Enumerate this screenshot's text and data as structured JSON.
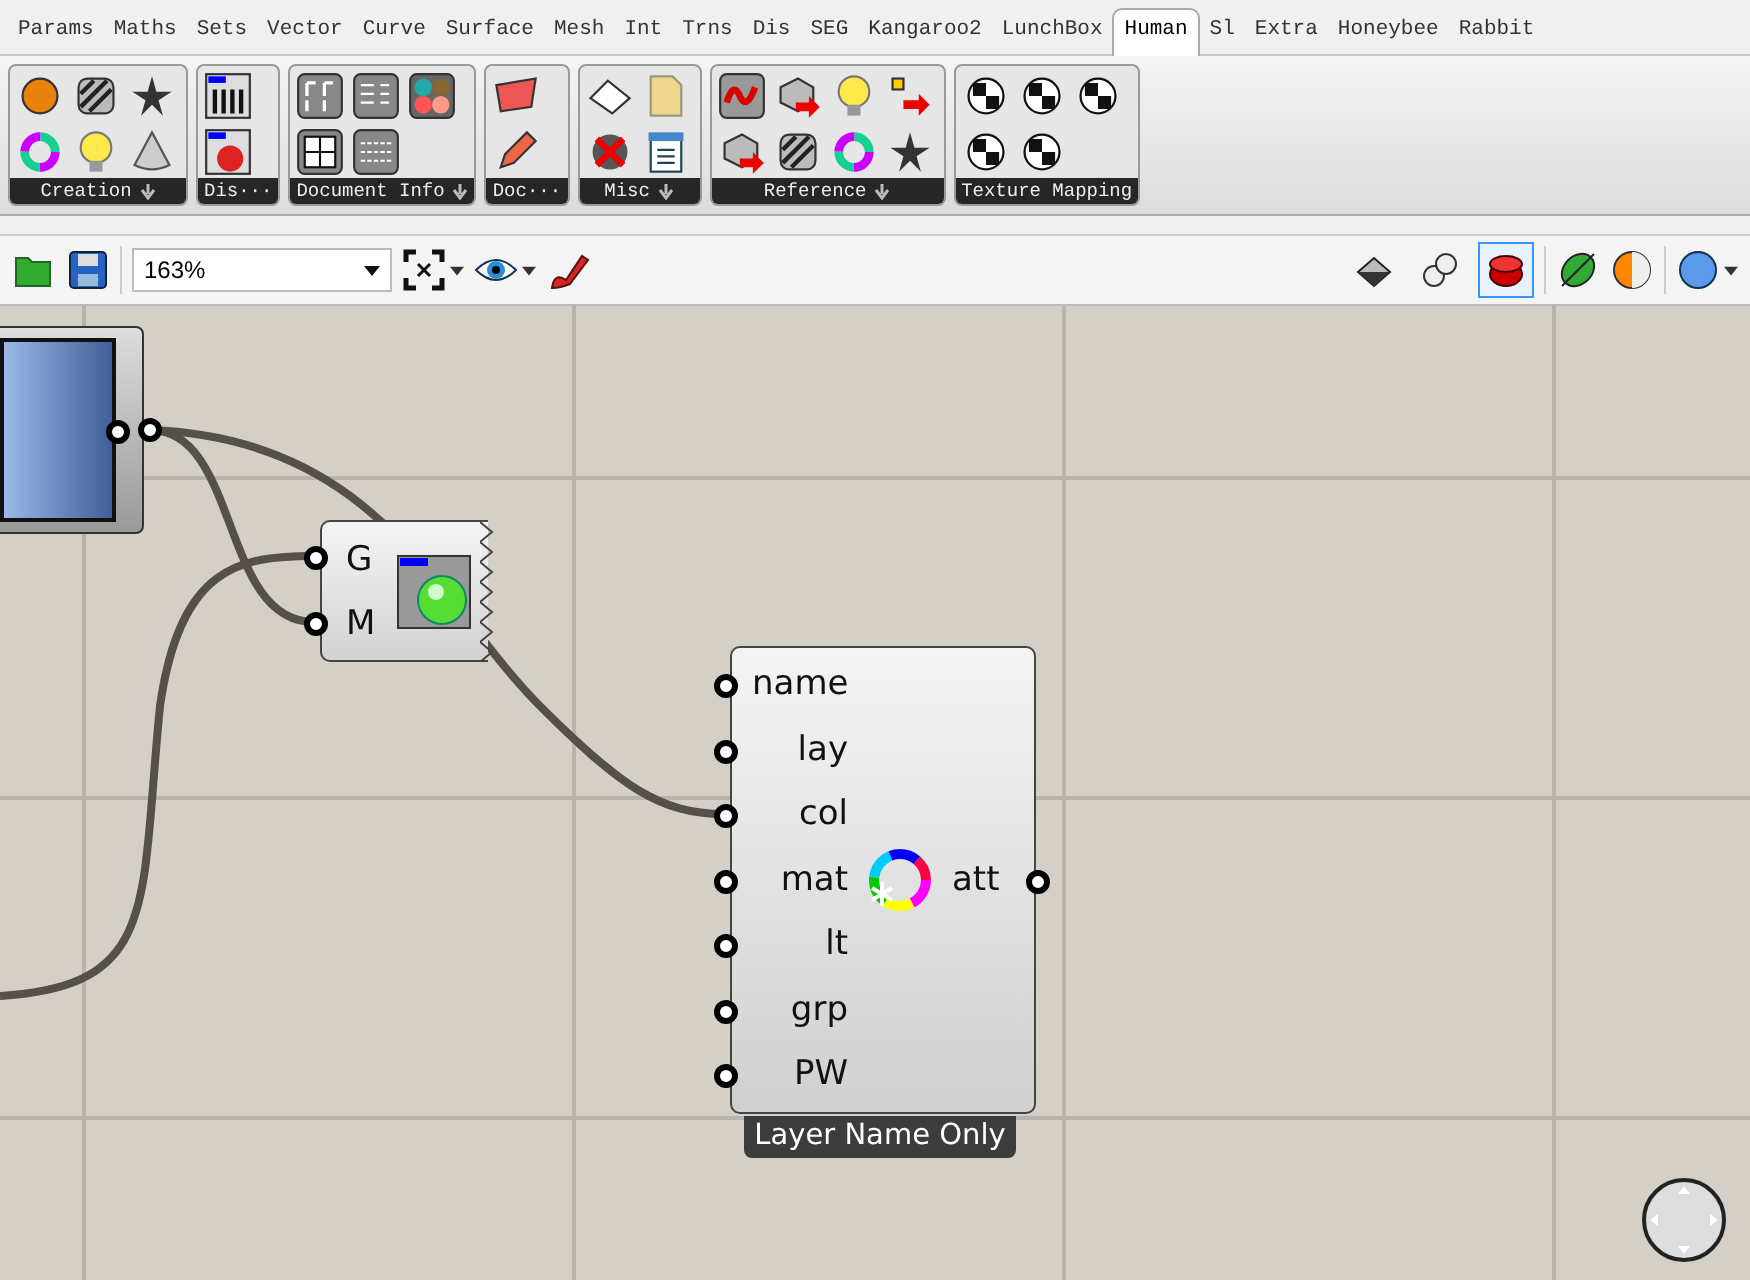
{
  "tabs": [
    {
      "label": "Params",
      "selected": false
    },
    {
      "label": "Maths",
      "selected": false
    },
    {
      "label": "Sets",
      "selected": false
    },
    {
      "label": "Vector",
      "selected": false
    },
    {
      "label": "Curve",
      "selected": false
    },
    {
      "label": "Surface",
      "selected": false
    },
    {
      "label": "Mesh",
      "selected": false
    },
    {
      "label": "Int",
      "selected": false
    },
    {
      "label": "Trns",
      "selected": false
    },
    {
      "label": "Dis",
      "selected": false
    },
    {
      "label": "SEG",
      "selected": false
    },
    {
      "label": "Kangaroo2",
      "selected": false
    },
    {
      "label": "LunchBox",
      "selected": false
    },
    {
      "label": "Human",
      "selected": true
    },
    {
      "label": "Sl",
      "selected": false
    },
    {
      "label": "Extra",
      "selected": false
    },
    {
      "label": "Honeybee",
      "selected": false
    },
    {
      "label": "Rabbit",
      "selected": false
    }
  ],
  "ribbon_panels": [
    {
      "label": "Creation",
      "has_menu": true
    },
    {
      "label": "Dis···",
      "has_menu": false
    },
    {
      "label": "Document Info",
      "has_menu": true
    },
    {
      "label": "Doc···",
      "has_menu": false
    },
    {
      "label": "Misc",
      "has_menu": true
    },
    {
      "label": "Reference",
      "has_menu": true
    },
    {
      "label": "Texture Mapping",
      "has_menu": false
    }
  ],
  "toolbar": {
    "zoom": "163%",
    "preview_buttons": [
      {
        "selected": false
      },
      {
        "selected": false
      },
      {
        "selected": true
      }
    ]
  },
  "canvas": {
    "color_component": {
      "inputs": [
        "G",
        "M"
      ]
    },
    "attributes_component": {
      "inputs": [
        "name",
        "lay",
        "col",
        "mat",
        "lt",
        "grp",
        "PW"
      ],
      "output": "att",
      "label": "Layer Name Only"
    }
  }
}
